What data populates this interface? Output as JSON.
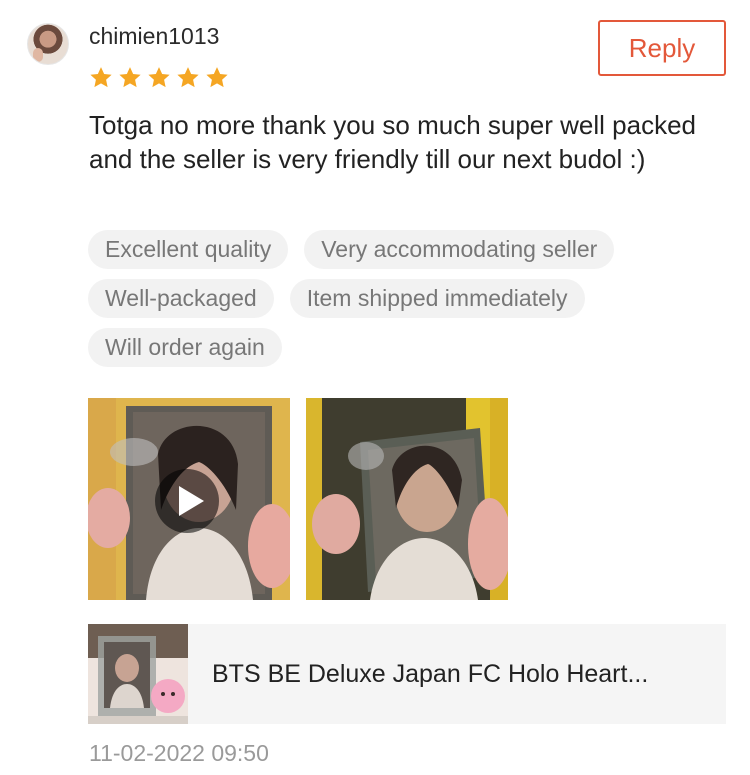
{
  "review": {
    "username": "chimien1013",
    "rating": 5,
    "reply_label": "Reply",
    "text": "Totga no more thank you so much super well packed and the seller is very friendly till our next budol :)",
    "tags": [
      "Excellent quality",
      "Very accommodating seller",
      "Well-packaged",
      "Item shipped immediately",
      "Will order again"
    ],
    "media": [
      {
        "kind": "video",
        "icon": "play-icon"
      },
      {
        "kind": "photo"
      }
    ],
    "product_name": "BTS BE Deluxe Japan FC Holo Heart...",
    "timestamp": "11-02-2022 09:50"
  },
  "colors": {
    "accent": "#e3583a",
    "star": "#f5a623",
    "tag_bg": "#f2f2f2",
    "card_bg": "#f5f5f5"
  }
}
